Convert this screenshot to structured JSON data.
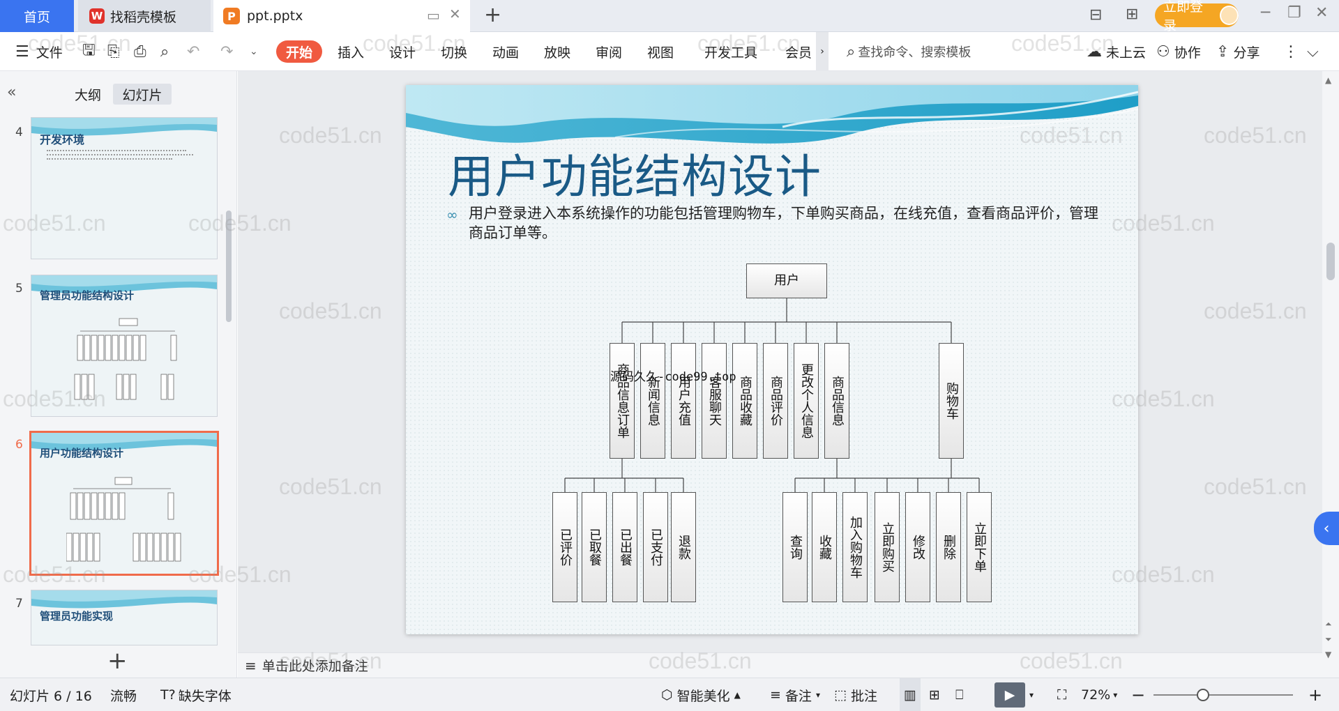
{
  "tabs": {
    "home": "首页",
    "template": "找稻壳模板",
    "file": "ppt.pptx"
  },
  "login": "立即登录",
  "toolbar": {
    "file_menu": "文件",
    "start": "开始",
    "insert": "插入",
    "design": "设计",
    "switch": "切换",
    "animation": "动画",
    "slideshow": "放映",
    "review": "审阅",
    "view": "视图",
    "dev_tools": "开发工具",
    "member": "会员",
    "search_placeholder": "查找命令、搜索模板",
    "cloud": "未上云",
    "collaborate": "协作",
    "share": "分享"
  },
  "panel": {
    "outline": "大纲",
    "slides": "幻灯片"
  },
  "thumbnails": [
    {
      "num": "4",
      "title": "开发环境"
    },
    {
      "num": "5",
      "title": "管理员功能结构设计"
    },
    {
      "num": "6",
      "title": "用户功能结构设计"
    },
    {
      "num": "7",
      "title": "管理员功能实现"
    }
  ],
  "slide": {
    "title": "用户功能结构设计",
    "body": "用户登录进入本系统操作的功能包括管理购物车，下单购买商品，在线充值，查看商品评价，管理商品订单等。",
    "root": "用户",
    "level1": [
      "商品信息订单",
      "新闻信息",
      "用户充值",
      "客服聊天",
      "商品收藏",
      "商品评价",
      "更改个人信息",
      "商品信息",
      "购物车"
    ],
    "order_children": [
      "已评价",
      "已取餐",
      "已出餐",
      "已支付",
      "退款"
    ],
    "cart_children": [
      "查询",
      "收藏",
      "加入购物车",
      "立即购买",
      "修改",
      "删除",
      "立即下单"
    ],
    "overlay_text": "源码久久-code99.top"
  },
  "notes_placeholder": "单击此处添加备注",
  "status": {
    "slide_info": "幻灯片 6 / 16",
    "smooth": "流畅",
    "missing_font": "缺失字体",
    "beautify": "智能美化",
    "notes": "备注",
    "comments": "批注",
    "zoom": "72%"
  },
  "watermark": "code51.cn"
}
